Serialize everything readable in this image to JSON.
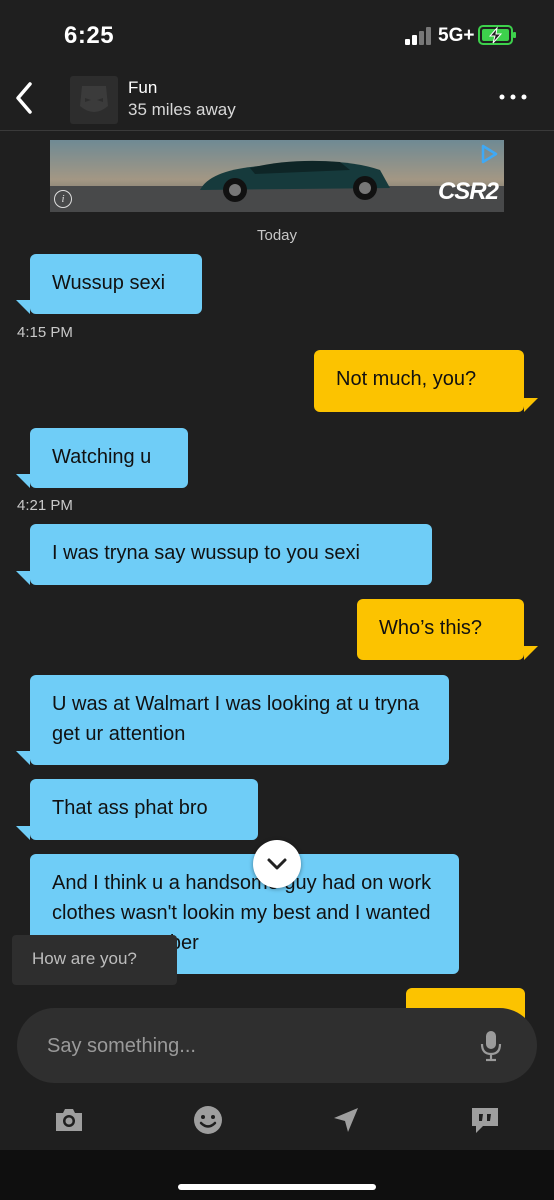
{
  "status": {
    "time": "6:25",
    "network": "5G+"
  },
  "header": {
    "name": "Fun",
    "distance": "35 miles away"
  },
  "ad": {
    "brand": "CSR2"
  },
  "chat": {
    "date_label": "Today",
    "messages": [
      {
        "dir": "in",
        "text": "Wussup sexi"
      },
      {
        "dir": "out",
        "text": "Not much, you?"
      },
      {
        "dir": "in",
        "text": "Watching u"
      },
      {
        "dir": "in",
        "text": "I was tryna say wussup to you sexi"
      },
      {
        "dir": "out",
        "text": "Who’s this?"
      },
      {
        "dir": "in",
        "text": "U was at Walmart I was looking at u tryna get ur attention"
      },
      {
        "dir": "in",
        "text": "That ass phat bro"
      },
      {
        "dir": "in",
        "text": "And I think u a handsome guy had on work clothes wasn't lookin my best and I wanted to get ur number"
      }
    ],
    "timestamps": [
      "4:15 PM",
      "4:21 PM"
    ]
  },
  "suggestion": {
    "text": "How are you?"
  },
  "composer": {
    "placeholder": "Say something..."
  },
  "colors": {
    "incoming": "#6fcdf7",
    "outgoing": "#fcc300",
    "background": "#1f1f1f"
  },
  "icons": [
    "back-icon",
    "more-icon",
    "ad-choices-icon",
    "info-icon",
    "chevron-down-icon",
    "mic-icon",
    "camera-icon",
    "emoji-icon",
    "location-icon",
    "quick-reply-icon"
  ]
}
